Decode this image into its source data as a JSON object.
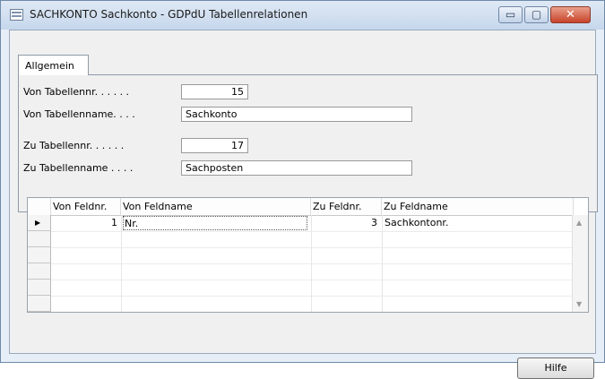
{
  "window": {
    "title": "SACHKONTO Sachkonto - GDPdU Tabellenrelationen",
    "controls": {
      "minimize": "▭",
      "maximize": "▢",
      "close": "✕"
    }
  },
  "tabs": [
    {
      "label": "Allgemein",
      "selected": true
    }
  ],
  "form": {
    "von_tabellennr": {
      "label": "Von Tabellennr. . . . . .",
      "value": "15"
    },
    "von_tabellenname": {
      "label": "Von Tabellenname. . . .",
      "value": "Sachkonto"
    },
    "zu_tabellennr": {
      "label": "Zu Tabellennr. . . . . .",
      "value": "17"
    },
    "zu_tabellenname": {
      "label": "Zu Tabellenname . . . .",
      "value": "Sachposten"
    }
  },
  "table": {
    "columns": [
      "Von Feldnr.",
      "Von Feldname",
      "Zu Feldnr.",
      "Zu Feldname"
    ],
    "rows": [
      {
        "von_feldnr": "1",
        "von_feldname": "Nr.",
        "zu_feldnr": "3",
        "zu_feldname": "Sachkontonr.",
        "current": true
      }
    ],
    "row_indicator": "▶"
  },
  "buttons": {
    "hilfe": "Hilfe"
  },
  "icons": [
    "table-window-icon",
    "row-pointer-icon",
    "scroll-up-icon",
    "scroll-down-icon"
  ]
}
